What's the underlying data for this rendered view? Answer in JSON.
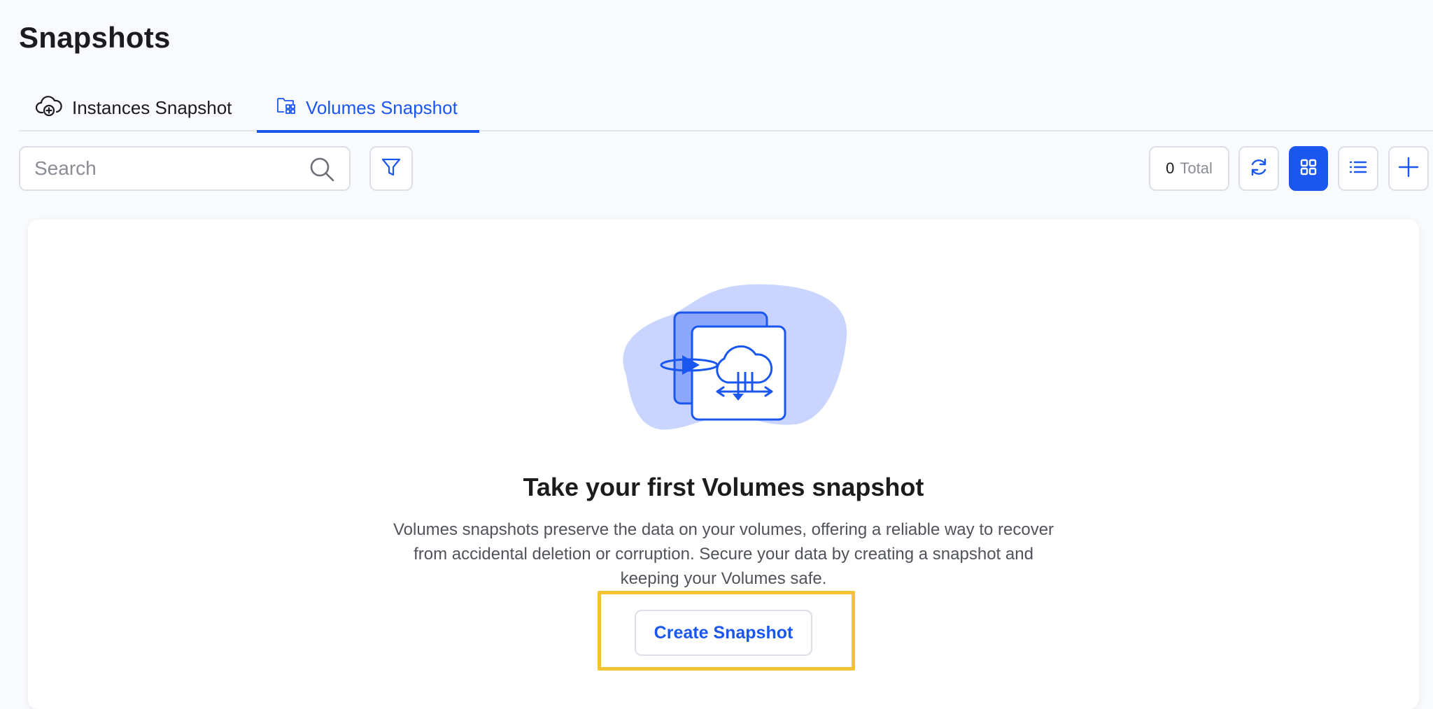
{
  "page": {
    "title": "Snapshots"
  },
  "tabs": [
    {
      "label": "Instances Snapshot",
      "icon": "cloud-add-icon",
      "active": false
    },
    {
      "label": "Volumes Snapshot",
      "icon": "folder-grid-icon",
      "active": true
    }
  ],
  "toolbar": {
    "search_placeholder": "Search",
    "total_count": "0",
    "total_label": "Total",
    "view_mode": "grid"
  },
  "empty_state": {
    "title": "Take your first Volumes snapshot",
    "description": "Volumes snapshots preserve the data on your volumes, offering a reliable way to recover from accidental deletion or corruption. Secure your data by creating a snapshot and keeping your Volumes safe.",
    "button_label": "Create Snapshot"
  },
  "colors": {
    "accent": "#1a56f0",
    "highlight": "#f3c334",
    "illustration_blob": "#c9d4ff"
  }
}
